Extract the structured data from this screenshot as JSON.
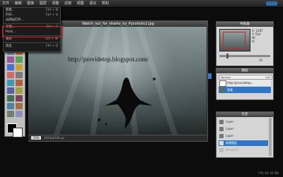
{
  "menubar": {
    "items": [
      "文件",
      "编辑",
      "图像",
      "图层",
      "调整",
      "滤镜",
      "视图",
      "语言",
      "帮助"
    ]
  },
  "file_menu": {
    "items": [
      {
        "label": "新建...",
        "shortcut": "Ctrl + N"
      },
      {
        "label": "打开...",
        "shortcut": "Ctrl + O"
      },
      {
        "label": "从网址打开...",
        "shortcut": ""
      },
      {
        "label": "存储...",
        "shortcut": "Ctrl + S"
      },
      {
        "label": "Print...",
        "shortcut": ""
      },
      {
        "label": "关闭",
        "shortcut": "Ctrl + W"
      },
      {
        "label": "退出",
        "shortcut": "Ctrl + Q"
      }
    ]
  },
  "image_window": {
    "title": "Watch_out_for_sharks_by_Pycoholic2.jpg",
    "overlay_text": "http://providetop.blogspot.com/",
    "zoom": "33%",
    "dimensions": "1024x1024 px"
  },
  "navigator": {
    "title": "导航器",
    "x_label": "X:",
    "x_value": "1287",
    "y_label": "Y:",
    "y_value": "554",
    "w_label": "W:",
    "h_label": "H:",
    "zoom": "33"
  },
  "layers": {
    "title": "图层",
    "mode": "Normal",
    "opacity": "100",
    "items": [
      {
        "name": "http://providetop..."
      },
      {
        "name": "背景"
      }
    ]
  },
  "history": {
    "title": "历史",
    "items": [
      "Layer",
      "Layer",
      "Layer",
      "新建图层",
      "Deselect"
    ]
  },
  "footer": {
    "fps": "FPS 38, 64 MB"
  },
  "colors": {
    "highlight": "#d82020",
    "selection": "#2f77c6"
  }
}
